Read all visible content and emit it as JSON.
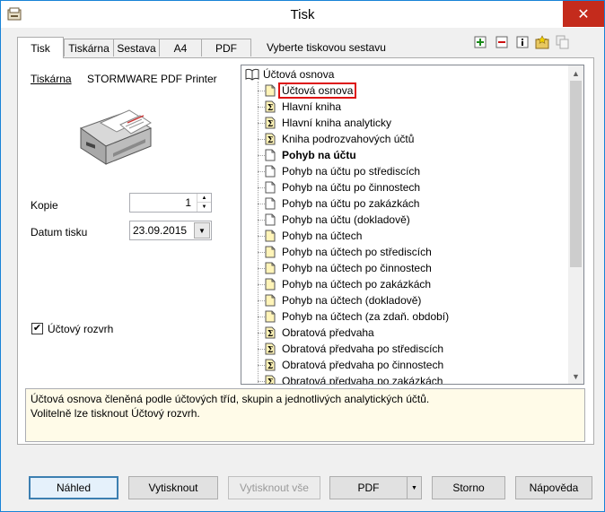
{
  "window": {
    "title": "Tisk"
  },
  "tabs": [
    {
      "label": "Tisk",
      "active": true
    },
    {
      "label": "Tiskárna",
      "active": false
    },
    {
      "label": "Sestava",
      "active": false
    },
    {
      "label": "A4",
      "active": false
    },
    {
      "label": "PDF",
      "active": false
    }
  ],
  "report_select_label": "Vyberte tiskovou sestavu",
  "toolbar": {
    "add_icon": "plus-icon",
    "remove_icon": "minus-icon",
    "info_icon": "info-icon",
    "favorites_icon": "star-folder-icon",
    "copy_icon": "copy-icon"
  },
  "printer": {
    "label": "Tiskárna",
    "name": "STORMWARE PDF Printer"
  },
  "copies": {
    "label": "Kopie",
    "value": "1"
  },
  "print_date": {
    "label": "Datum tisku",
    "value": "23.09.2015"
  },
  "account_layout": {
    "label": "Účtový rozvrh",
    "checked": true
  },
  "tree": {
    "root": "Účtová osnova",
    "items": [
      {
        "label": "Účtová osnova",
        "icon": "page-yellow",
        "selected": true
      },
      {
        "label": "Hlavní kniha",
        "icon": "sigma"
      },
      {
        "label": "Hlavní kniha analyticky",
        "icon": "sigma"
      },
      {
        "label": "Kniha podrozvahových účtů",
        "icon": "sigma"
      },
      {
        "label": "Pohyb na účtu",
        "icon": "page-white",
        "bold": true
      },
      {
        "label": "Pohyb na účtu po střediscích",
        "icon": "page-white"
      },
      {
        "label": "Pohyb na účtu po činnostech",
        "icon": "page-white"
      },
      {
        "label": "Pohyb na účtu po zakázkách",
        "icon": "page-white"
      },
      {
        "label": "Pohyb na účtu (dokladově)",
        "icon": "page-white"
      },
      {
        "label": "Pohyb na účtech",
        "icon": "page-yellow"
      },
      {
        "label": "Pohyb na účtech po střediscích",
        "icon": "page-yellow"
      },
      {
        "label": "Pohyb na účtech po činnostech",
        "icon": "page-yellow"
      },
      {
        "label": "Pohyb na účtech po zakázkách",
        "icon": "page-yellow"
      },
      {
        "label": "Pohyb na účtech (dokladově)",
        "icon": "page-yellow"
      },
      {
        "label": "Pohyb na účtech (za zdaň. období)",
        "icon": "page-yellow"
      },
      {
        "label": "Obratová předvaha",
        "icon": "sigma"
      },
      {
        "label": "Obratová předvaha po střediscích",
        "icon": "sigma"
      },
      {
        "label": "Obratová předvaha po činnostech",
        "icon": "sigma"
      },
      {
        "label": "Obratová předvaha po zakázkách",
        "icon": "sigma"
      }
    ]
  },
  "description": {
    "line1": "Účtová osnova členěná podle účtových tříd, skupin a jednotlivých analytických účtů.",
    "line2": "Volitelně lze tisknout Účtový rozvrh."
  },
  "buttons": {
    "preview": "Náhled",
    "print": "Vytisknout",
    "print_all": "Vytisknout vše",
    "pdf": "PDF",
    "cancel": "Storno",
    "help": "Nápověda"
  },
  "colors": {
    "accent": "#1883d7",
    "close": "#c42b1c",
    "selection_outline": "#dd1111",
    "desc_bg": "#fffbe8"
  }
}
